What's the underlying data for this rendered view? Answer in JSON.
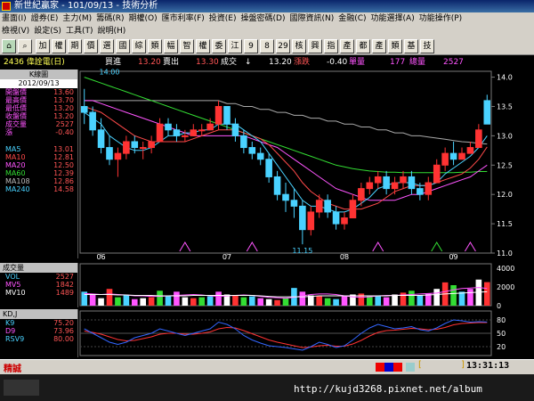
{
  "window": {
    "title": "新世紀贏家 - 101/09/13 - 技術分析"
  },
  "menu": {
    "row1": [
      "畫面(I)",
      "證券(E)",
      "主力(M)",
      "籌碼(R)",
      "期權(O)",
      "匯市利率(F)",
      "投資(E)",
      "操盤密碼(D)",
      "國際資訊(N)",
      "金融(C)",
      "功能選擇(A)",
      "功能操作(P)"
    ],
    "row2": [
      "檢視(V)",
      "設定(S)",
      "工具(T)",
      "說明(H)"
    ]
  },
  "toolbar": {
    "buttons": [
      "加",
      "權",
      "期",
      "價",
      "選",
      "國",
      "綜",
      "類",
      "幅",
      "智",
      "權",
      "委",
      "江",
      "9",
      "8",
      "29",
      "核",
      "興",
      "指",
      "產",
      "都",
      "產",
      "類",
      "基",
      "技"
    ]
  },
  "quote": {
    "code_name": "2436 偉詮電(日)",
    "buy_label": "買進",
    "buy": "13.20",
    "sell_label": "賣出",
    "sell": "13.30",
    "deal_label": "成交",
    "deal": "13.20",
    "chg_label": "漲跌",
    "chg": "-0.40",
    "vol_label": "單量",
    "vol": "177",
    "total_label": "總量",
    "total": "2527"
  },
  "left": {
    "title": "K線圖",
    "date": "2012/09/13",
    "ohlc": [
      {
        "k": "開盤價",
        "v": "13.60"
      },
      {
        "k": "最高價",
        "v": "13.70"
      },
      {
        "k": "最低價",
        "v": "13.20"
      },
      {
        "k": "收盤價",
        "v": "13.20"
      },
      {
        "k": "成交量",
        "v": "2527"
      },
      {
        "k": "漲",
        "v": "-0.40"
      }
    ],
    "ma": [
      {
        "k": "MA5",
        "v": "13.01",
        "c": "#4ad2ff"
      },
      {
        "k": "MA10",
        "v": "12.81",
        "c": "#ff4a4a"
      },
      {
        "k": "MA20",
        "v": "12.50",
        "c": "#ff55ff"
      },
      {
        "k": "MA60",
        "v": "12.39",
        "c": "#33dd33"
      },
      {
        "k": "MA108",
        "v": "12.86",
        "c": "#bbbbbb"
      },
      {
        "k": "MA240",
        "v": "14.58",
        "c": "#4ad2ff"
      }
    ]
  },
  "volpanel": {
    "title": "成交量",
    "rows": [
      {
        "k": "VOL",
        "v": "2527",
        "c": "#4ad2ff"
      },
      {
        "k": "MV5",
        "v": "1842",
        "c": "#ff55ff"
      },
      {
        "k": "MV10",
        "v": "1489",
        "c": "#ffffff"
      }
    ]
  },
  "kdpanel": {
    "title": "KD,J",
    "rows": [
      {
        "k": "K9",
        "v": "75.20",
        "c": "#4ad2ff"
      },
      {
        "k": "D9",
        "v": "73.96",
        "c": "#ff55ff"
      },
      {
        "k": "RSV9",
        "v": "80.00",
        "c": "#4ad2ff"
      }
    ]
  },
  "status": {
    "left": "精誠",
    "time": "13:31:13"
  },
  "taskbar": {
    "watermark": "http://kujd3268.pixnet.net/album"
  },
  "chart_data": [
    {
      "type": "candlestick",
      "x": [
        "06",
        "07",
        "08",
        "09"
      ],
      "annotations": [
        "14.00",
        "11.15"
      ],
      "ylim": [
        11.0,
        14.1
      ],
      "yticks": [
        11.0,
        11.5,
        12.0,
        12.5,
        13.0,
        13.5,
        14.0
      ],
      "ohlc": [
        [
          13.5,
          13.8,
          13.2,
          13.4
        ],
        [
          13.4,
          13.5,
          13.0,
          13.1
        ],
        [
          13.1,
          13.3,
          12.7,
          12.8
        ],
        [
          12.8,
          13.0,
          12.5,
          12.6
        ],
        [
          12.6,
          12.8,
          12.3,
          12.7
        ],
        [
          12.7,
          13.0,
          12.6,
          12.9
        ],
        [
          12.9,
          13.0,
          12.7,
          12.8
        ],
        [
          12.8,
          12.9,
          12.6,
          12.8
        ],
        [
          12.8,
          13.0,
          12.7,
          12.9
        ],
        [
          12.9,
          13.3,
          12.9,
          13.2
        ],
        [
          13.2,
          13.3,
          13.0,
          13.1
        ],
        [
          13.1,
          13.2,
          12.9,
          13.0
        ],
        [
          13.0,
          13.1,
          12.9,
          13.0
        ],
        [
          13.0,
          13.2,
          13.0,
          13.1
        ],
        [
          13.1,
          13.2,
          13.0,
          13.1
        ],
        [
          13.1,
          13.3,
          13.1,
          13.2
        ],
        [
          13.2,
          13.6,
          13.1,
          13.5
        ],
        [
          13.5,
          13.5,
          13.1,
          13.2
        ],
        [
          13.2,
          13.3,
          12.9,
          13.0
        ],
        [
          13.0,
          13.1,
          12.7,
          12.8
        ],
        [
          12.8,
          12.9,
          12.6,
          12.7
        ],
        [
          12.7,
          12.8,
          12.5,
          12.6
        ],
        [
          12.6,
          12.7,
          12.2,
          12.3
        ],
        [
          12.3,
          12.4,
          11.9,
          12.0
        ],
        [
          12.0,
          12.2,
          11.7,
          11.9
        ],
        [
          11.9,
          12.1,
          11.6,
          11.8
        ],
        [
          11.8,
          11.9,
          11.15,
          11.4
        ],
        [
          11.4,
          11.8,
          11.3,
          11.7
        ],
        [
          11.7,
          12.0,
          11.6,
          11.9
        ],
        [
          11.9,
          12.0,
          11.6,
          11.7
        ],
        [
          11.7,
          11.8,
          11.4,
          11.5
        ],
        [
          11.5,
          11.7,
          11.4,
          11.6
        ],
        [
          11.6,
          12.0,
          11.6,
          11.9
        ],
        [
          11.9,
          12.2,
          11.8,
          12.1
        ],
        [
          12.1,
          12.3,
          12.0,
          12.2
        ],
        [
          12.2,
          12.4,
          12.1,
          12.3
        ],
        [
          12.3,
          12.4,
          12.0,
          12.1
        ],
        [
          12.1,
          12.3,
          12.0,
          12.2
        ],
        [
          12.2,
          12.4,
          12.1,
          12.3
        ],
        [
          12.3,
          12.4,
          12.0,
          12.1
        ],
        [
          12.1,
          12.2,
          11.9,
          12.0
        ],
        [
          12.0,
          12.3,
          11.9,
          12.2
        ],
        [
          12.2,
          12.6,
          12.2,
          12.5
        ],
        [
          12.5,
          12.8,
          12.4,
          12.7
        ],
        [
          12.7,
          12.9,
          12.5,
          12.6
        ],
        [
          12.6,
          12.8,
          12.6,
          12.7
        ],
        [
          12.7,
          12.9,
          12.7,
          12.8
        ],
        [
          12.8,
          13.2,
          12.8,
          13.1
        ],
        [
          13.6,
          13.7,
          13.2,
          13.2
        ]
      ],
      "ma5": [
        13.4,
        13.3,
        13.2,
        13.0,
        12.9,
        12.8,
        12.75,
        12.75,
        12.8,
        12.9,
        13.0,
        13.0,
        13.05,
        13.05,
        13.1,
        13.1,
        13.2,
        13.2,
        13.2,
        13.1,
        13.0,
        12.9,
        12.7,
        12.5,
        12.3,
        12.1,
        11.9,
        11.8,
        11.8,
        11.75,
        11.7,
        11.7,
        11.75,
        11.85,
        11.95,
        12.1,
        12.15,
        12.2,
        12.2,
        12.2,
        12.15,
        12.15,
        12.2,
        12.35,
        12.45,
        12.55,
        12.65,
        12.8,
        13.0
      ],
      "ma10": [
        13.5,
        13.45,
        13.4,
        13.3,
        13.2,
        13.1,
        13.0,
        12.95,
        12.9,
        12.9,
        12.9,
        12.9,
        12.9,
        12.95,
        13.0,
        13.05,
        13.1,
        13.1,
        13.1,
        13.05,
        13.0,
        12.95,
        12.85,
        12.7,
        12.55,
        12.4,
        12.2,
        12.05,
        11.95,
        11.85,
        11.8,
        11.75,
        11.75,
        11.75,
        11.8,
        11.85,
        11.95,
        12.05,
        12.1,
        12.15,
        12.15,
        12.15,
        12.2,
        12.25,
        12.3,
        12.35,
        12.45,
        12.6,
        12.81
      ],
      "ma20": [
        13.6,
        13.6,
        13.55,
        13.5,
        13.45,
        13.4,
        13.35,
        13.3,
        13.25,
        13.2,
        13.15,
        13.1,
        13.05,
        13.0,
        13.0,
        13.0,
        13.0,
        13.0,
        13.0,
        13.0,
        12.95,
        12.9,
        12.85,
        12.8,
        12.7,
        12.6,
        12.5,
        12.4,
        12.3,
        12.2,
        12.1,
        12.05,
        12.0,
        11.95,
        11.9,
        11.9,
        11.9,
        11.9,
        11.95,
        12.0,
        12.0,
        12.05,
        12.1,
        12.15,
        12.2,
        12.25,
        12.3,
        12.4,
        12.5
      ],
      "ma60": [
        14.0,
        13.95,
        13.9,
        13.85,
        13.8,
        13.75,
        13.7,
        13.65,
        13.6,
        13.55,
        13.5,
        13.45,
        13.4,
        13.35,
        13.3,
        13.25,
        13.2,
        13.15,
        13.1,
        13.05,
        13.0,
        12.95,
        12.9,
        12.85,
        12.8,
        12.75,
        12.7,
        12.65,
        12.6,
        12.55,
        12.5,
        12.47,
        12.44,
        12.42,
        12.4,
        12.39,
        12.38,
        12.38,
        12.37,
        12.37,
        12.37,
        12.37,
        12.37,
        12.37,
        12.37,
        12.38,
        12.38,
        12.39,
        12.39
      ],
      "ma108": [
        13.6,
        13.6,
        13.6,
        13.6,
        13.6,
        13.6,
        13.6,
        13.6,
        13.6,
        13.6,
        13.6,
        13.6,
        13.6,
        13.6,
        13.6,
        13.6,
        13.6,
        13.55,
        13.55,
        13.5,
        13.5,
        13.45,
        13.45,
        13.4,
        13.4,
        13.35,
        13.35,
        13.3,
        13.3,
        13.25,
        13.25,
        13.2,
        13.2,
        13.15,
        13.15,
        13.1,
        13.1,
        13.05,
        13.05,
        13.0,
        13.0,
        12.98,
        12.96,
        12.94,
        12.92,
        12.9,
        12.89,
        12.87,
        12.86
      ]
    },
    {
      "type": "bar",
      "name": "volume",
      "ylim": [
        0,
        4500
      ],
      "yticks": [
        0,
        2000,
        4000
      ],
      "values": [
        1500,
        1200,
        800,
        1800,
        900,
        1100,
        700,
        800,
        900,
        1600,
        1000,
        1500,
        900,
        800,
        900,
        1000,
        1500,
        1200,
        1100,
        900,
        1000,
        800,
        700,
        600,
        800,
        1900,
        1500,
        1100,
        1000,
        800,
        700,
        1000,
        1200,
        1300,
        1100,
        1000,
        900,
        1200,
        1400,
        1600,
        1100,
        1300,
        1800,
        2500,
        2200,
        1500,
        1800,
        2800,
        2527
      ],
      "mv5": [
        1300,
        1250,
        1200,
        1250,
        1200,
        1150,
        1050,
        1050,
        1000,
        1000,
        1050,
        1100,
        1150,
        1200,
        1150,
        1050,
        1000,
        1050,
        1100,
        1150,
        1100,
        1000,
        900,
        850,
        800,
        900,
        1050,
        1200,
        1250,
        1250,
        1200,
        1050,
        950,
        900,
        950,
        1050,
        1100,
        1100,
        1150,
        1200,
        1250,
        1300,
        1350,
        1500,
        1700,
        1850,
        1900,
        1950,
        1842
      ],
      "mv10": [
        1200,
        1200,
        1200,
        1200,
        1150,
        1150,
        1100,
        1100,
        1100,
        1050,
        1050,
        1050,
        1050,
        1100,
        1100,
        1100,
        1100,
        1100,
        1100,
        1100,
        1100,
        1050,
        1000,
        950,
        950,
        950,
        950,
        1000,
        1050,
        1050,
        1050,
        1050,
        1050,
        1050,
        1050,
        1050,
        1050,
        1100,
        1100,
        1100,
        1100,
        1150,
        1200,
        1250,
        1300,
        1350,
        1400,
        1450,
        1489
      ]
    },
    {
      "type": "line",
      "name": "KD",
      "ylim": [
        0,
        100
      ],
      "yticks": [
        20,
        50,
        80
      ],
      "k": [
        60,
        50,
        40,
        30,
        25,
        30,
        40,
        45,
        50,
        60,
        55,
        50,
        45,
        50,
        55,
        60,
        75,
        70,
        60,
        45,
        35,
        28,
        22,
        20,
        18,
        15,
        12,
        20,
        30,
        25,
        18,
        22,
        35,
        50,
        62,
        70,
        65,
        60,
        62,
        65,
        58,
        55,
        62,
        72,
        80,
        78,
        75,
        76,
        75.2
      ],
      "d": [
        55,
        52,
        48,
        42,
        36,
        33,
        34,
        38,
        42,
        48,
        50,
        50,
        48,
        48,
        50,
        53,
        60,
        63,
        62,
        56,
        49,
        42,
        35,
        30,
        26,
        22,
        18,
        19,
        22,
        23,
        21,
        21,
        26,
        34,
        44,
        52,
        56,
        57,
        59,
        61,
        60,
        58,
        59,
        63,
        69,
        72,
        73,
        74,
        73.96
      ]
    }
  ]
}
